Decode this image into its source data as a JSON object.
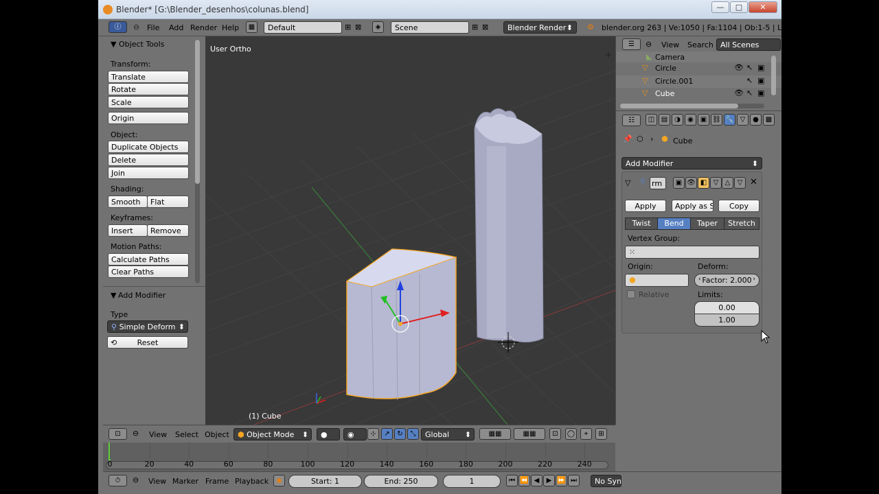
{
  "window": {
    "title": "Blender* [G:\\Blender_desenhos\\colunas.blend]",
    "minimize": "—",
    "maximize": "□",
    "close": "✕"
  },
  "menubar": {
    "menus": [
      "File",
      "Add",
      "Render",
      "Help"
    ],
    "layout": "Default",
    "scene": "Scene",
    "engine": "Blender Render",
    "stats": "blender.org 263 | Ve:1050 | Fa:1104 | Ob:1-5 | La:1 | M"
  },
  "toolshelf": {
    "title": "Object Tools",
    "transform_label": "Transform:",
    "translate": "Translate",
    "rotate": "Rotate",
    "scale": "Scale",
    "origin": "Origin",
    "object_label": "Object:",
    "duplicate": "Duplicate Objects",
    "delete": "Delete",
    "join": "Join",
    "shading_label": "Shading:",
    "smooth": "Smooth",
    "flat": "Flat",
    "keyframes_label": "Keyframes:",
    "insert": "Insert",
    "remove": "Remove",
    "motion_label": "Motion Paths:",
    "calc_paths": "Calculate Paths",
    "clear_paths": "Clear Paths",
    "add_modifier_title": "Add Modifier",
    "type_label": "Type",
    "type_value": "Simple Deform",
    "reset": "Reset"
  },
  "viewport": {
    "view_name": "User Ortho",
    "object_label": "(1) Cube"
  },
  "outliner": {
    "view": "View",
    "search": "Search",
    "scenes": "All Scenes",
    "items": [
      "Camera",
      "Circle",
      "Circle.001",
      "Cube"
    ]
  },
  "properties": {
    "breadcrumb": "Cube",
    "add_modifier": "Add Modifier",
    "modifier_name": "rm",
    "apply": "Apply",
    "apply_shape": "Apply as Sha",
    "copy": "Copy",
    "modes": [
      "Twist",
      "Bend",
      "Taper",
      "Stretch"
    ],
    "active_mode": "Bend",
    "vertex_group_label": "Vertex Group:",
    "origin_label": "Origin:",
    "deform_label": "Deform:",
    "factor": "Factor: 2.000",
    "relative": "Relative",
    "limits_label": "Limits:",
    "limit_low": "0.00",
    "limit_high": "1.00"
  },
  "view3d_header": {
    "view": "View",
    "select": "Select",
    "object": "Object",
    "mode": "Object Mode",
    "orientation": "Global"
  },
  "timeline": {
    "ticks": [
      "0",
      "20",
      "40",
      "60",
      "80",
      "100",
      "120",
      "140",
      "160",
      "180",
      "200",
      "220",
      "240"
    ]
  },
  "timeline_header": {
    "view": "View",
    "marker": "Marker",
    "frame": "Frame",
    "playback": "Playback",
    "start": "Start: 1",
    "end": "End: 250",
    "current": "1",
    "sync": "No Sync"
  },
  "colors": {
    "accent": "#5680c2",
    "selection": "#f5a623",
    "viewport_bg": "#393939"
  }
}
